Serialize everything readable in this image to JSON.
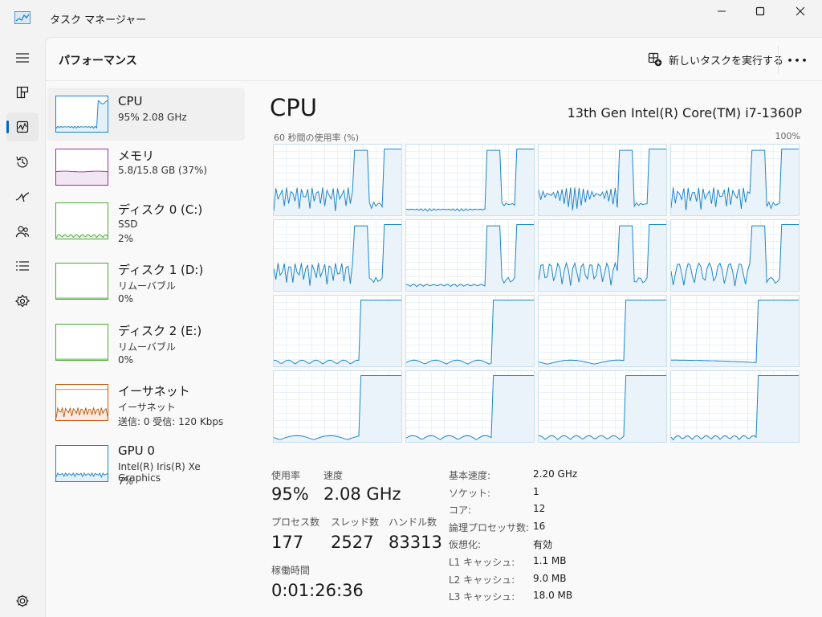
{
  "window": {
    "title": "タスク マネージャー",
    "icons": {
      "app": "task-manager-icon",
      "minimize": "minimize-icon",
      "maximize": "maximize-icon",
      "close": "close-icon"
    }
  },
  "nav": {
    "items": [
      {
        "name": "hamburger-menu-icon"
      },
      {
        "name": "processes-icon"
      },
      {
        "name": "performance-icon",
        "active": true
      },
      {
        "name": "app-history-icon"
      },
      {
        "name": "startup-apps-icon"
      },
      {
        "name": "users-icon"
      },
      {
        "name": "details-icon"
      },
      {
        "name": "services-icon"
      },
      {
        "name": "settings-icon"
      }
    ]
  },
  "header": {
    "title": "パフォーマンス",
    "new_task_label": "新しいタスクを実行する",
    "more_label": "•••"
  },
  "devices": [
    {
      "name": "CPU",
      "sub1": "95%  2.08 GHz",
      "sub2": "",
      "color": "#1b85c7",
      "active": true
    },
    {
      "name": "メモリ",
      "sub1": "5.8/15.8 GB (37%)",
      "sub2": "",
      "color": "#9b2ea0",
      "active": false
    },
    {
      "name": "ディスク 0 (C:)",
      "sub1": "SSD",
      "sub2": "2%",
      "color": "#4caa3a",
      "active": false
    },
    {
      "name": "ディスク 1 (D:)",
      "sub1": "リムーバブル",
      "sub2": "0%",
      "color": "#4caa3a",
      "active": false
    },
    {
      "name": "ディスク 2 (E:)",
      "sub1": "リムーバブル",
      "sub2": "0%",
      "color": "#4caa3a",
      "active": false
    },
    {
      "name": "イーサネット",
      "sub1": "イーサネット",
      "sub2": "送信: 0  受信: 120 Kbps",
      "color": "#c35a10",
      "active": false
    },
    {
      "name": "GPU 0",
      "sub1": "Intel(R) Iris(R) Xe Graphics",
      "sub2": "7%",
      "color": "#1b85c7",
      "active": false
    }
  ],
  "cpu": {
    "title": "CPU",
    "model": "13th Gen Intel(R) Core(TM) i7-1360P",
    "graph_axis_left": "60 秒間の使用率 (%)",
    "graph_axis_right": "100%",
    "graph_line_color": "#1b85c7",
    "graph_fill_color": "#eaf3fa",
    "graph_grid_color": "#dfe9f1",
    "core_count": 16,
    "stats": {
      "usage_label": "使用率",
      "usage_value": "95%",
      "speed_label": "速度",
      "speed_value": "2.08 GHz",
      "processes_label": "プロセス数",
      "processes_value": "177",
      "threads_label": "スレッド数",
      "threads_value": "2527",
      "handles_label": "ハンドル数",
      "handles_value": "83313",
      "uptime_label": "稼働時間",
      "uptime_value": "0:01:26:36"
    },
    "specs": [
      {
        "label": "基本速度:",
        "value": "2.20 GHz"
      },
      {
        "label": "ソケット:",
        "value": "1"
      },
      {
        "label": "コア:",
        "value": "12"
      },
      {
        "label": "論理プロセッサ数:",
        "value": "16"
      },
      {
        "label": "仮想化:",
        "value": "有効"
      },
      {
        "label": "L1 キャッシュ:",
        "value": "1.1 MB"
      },
      {
        "label": "L2 キャッシュ:",
        "value": "9.0 MB"
      },
      {
        "label": "L3 キャッシュ:",
        "value": "18.0 MB"
      }
    ]
  }
}
